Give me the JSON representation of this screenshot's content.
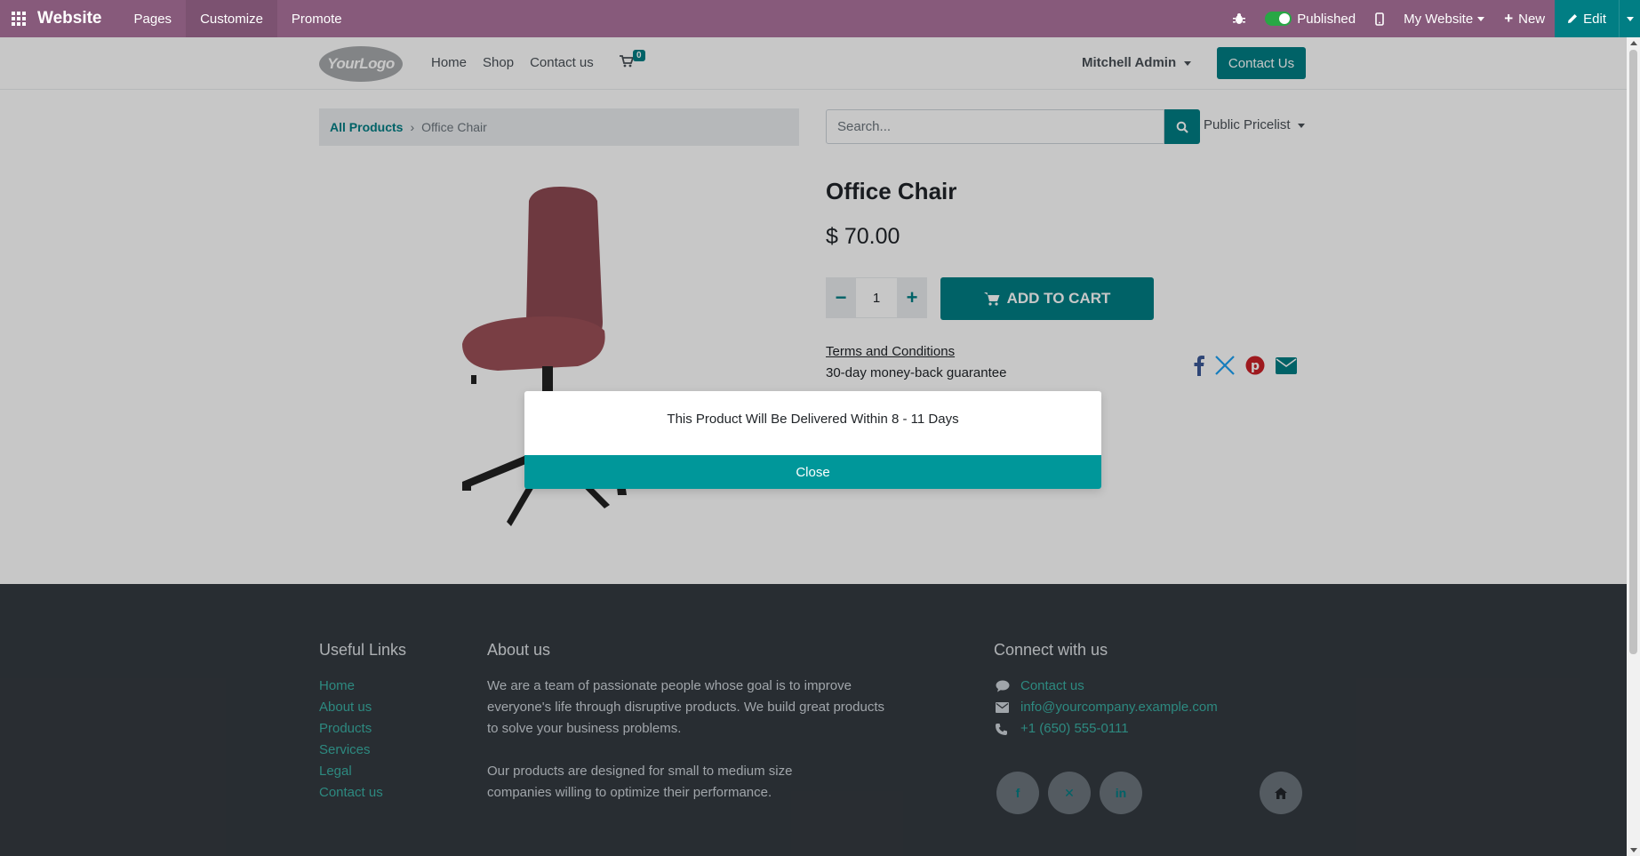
{
  "topbar": {
    "brand": "Website",
    "menus": [
      "Pages",
      "Customize",
      "Promote"
    ],
    "published_label": "Published",
    "my_website_label": "My Website",
    "new_label": "New",
    "edit_label": "Edit",
    "color": "#875a7b"
  },
  "header": {
    "logo_text": "YourLogo",
    "nav": [
      "Home",
      "Shop",
      "Contact us"
    ],
    "cart_count": "0",
    "user": "Mitchell Admin",
    "contact_button": "Contact Us"
  },
  "breadcrumb": {
    "parent": "All Products",
    "current": "Office Chair"
  },
  "search": {
    "placeholder": "Search...",
    "pricelist": "Public Pricelist"
  },
  "product": {
    "title": "Office Chair",
    "price": "$ 70.00",
    "quantity": "1",
    "add_to_cart": "ADD TO CART",
    "terms": "Terms and Conditions",
    "guarantee": "30-day money-back guarantee"
  },
  "dialog": {
    "message": "This Product Will Be Delivered Within 8 - 11 Days",
    "close_label": "Close"
  },
  "footer": {
    "useful_links_title": "Useful Links",
    "useful_links": [
      "Home",
      "About us",
      "Products",
      "Services",
      "Legal",
      "Contact us"
    ],
    "about_title": "About us",
    "about_p1": "We are a team of passionate people whose goal is to improve everyone's life through disruptive products. We build great products to solve your business problems.",
    "about_p2": "Our products are designed for small to medium size companies willing to optimize their performance.",
    "connect_title": "Connect with us",
    "contact_link": "Contact us",
    "email": "info@yourcompany.example.com",
    "phone": "+1 (650) 555-0111"
  },
  "colors": {
    "accent": "#017e84",
    "admin_bar": "#875a7b",
    "footer_bg": "#343a40"
  }
}
